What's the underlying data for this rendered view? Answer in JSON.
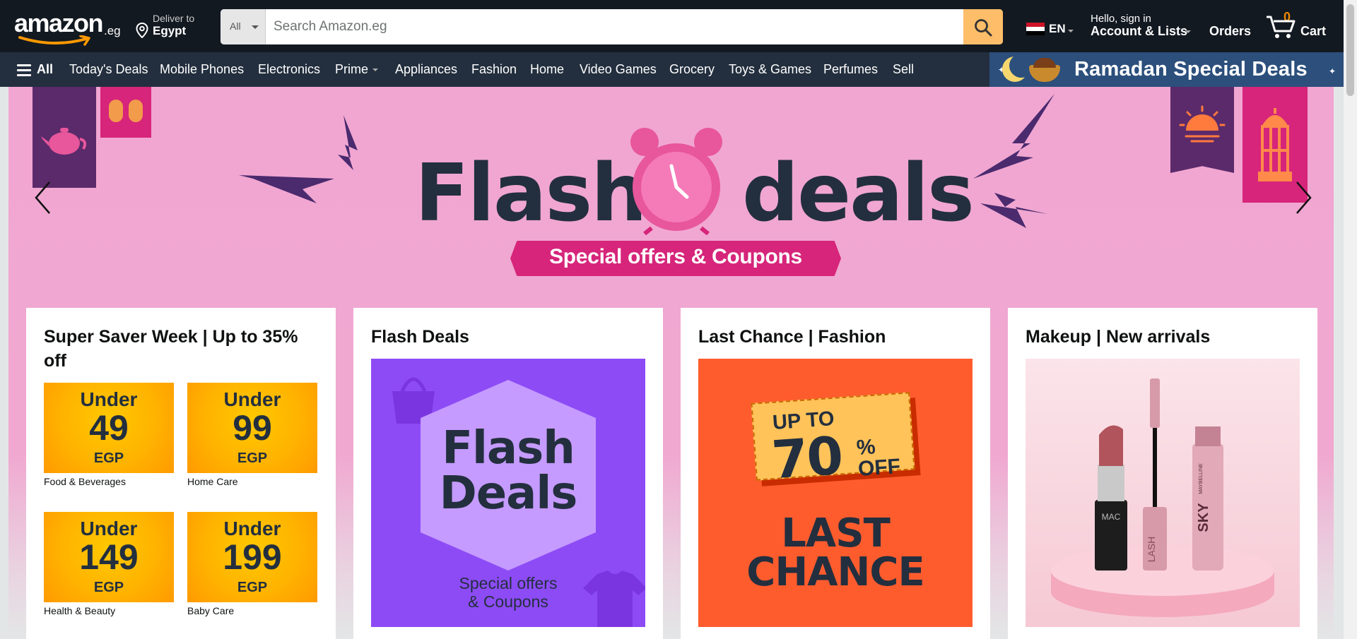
{
  "header": {
    "logo": {
      "text": "amazon",
      "tld": ".eg"
    },
    "deliver": {
      "line1": "Deliver to",
      "line2": "Egypt"
    },
    "search": {
      "category": "All",
      "placeholder": "Search Amazon.eg",
      "value": ""
    },
    "language": "EN",
    "account": {
      "line1": "Hello, sign in",
      "line2": "Account & Lists"
    },
    "orders": "Orders",
    "cart": {
      "count": "0",
      "label": "Cart"
    }
  },
  "subnav": {
    "all_label": "All",
    "items": [
      "Today's Deals",
      "Mobile Phones",
      "Electronics",
      "Prime",
      "Appliances",
      "Fashion",
      "Home",
      "Video Games",
      "Grocery",
      "Toys & Games",
      "Perfumes",
      "Sell"
    ],
    "promo": "Ramadan Special Deals"
  },
  "hero": {
    "title_left": "Flash",
    "title_right": "deals",
    "subtitle": "Special offers & Coupons",
    "colors": {
      "background": "#f1a6d2",
      "accent": "#d6257a",
      "dark": "#232f3e",
      "purple": "#5b2a6b"
    }
  },
  "cards": [
    {
      "title": "Super Saver Week | Up to 35% off",
      "tiles": [
        {
          "under": "Under",
          "price": "49",
          "currency": "EGP",
          "caption": "Food & Beverages"
        },
        {
          "under": "Under",
          "price": "99",
          "currency": "EGP",
          "caption": "Home Care"
        },
        {
          "under": "Under",
          "price": "149",
          "currency": "EGP",
          "caption": "Health & Beauty"
        },
        {
          "under": "Under",
          "price": "199",
          "currency": "EGP",
          "caption": "Baby Care"
        }
      ]
    },
    {
      "title": "Flash Deals",
      "image": {
        "line1": "Flash",
        "line2": "Deals",
        "small1": "Special offers",
        "small2": "& Coupons"
      }
    },
    {
      "title": "Last Chance | Fashion",
      "image": {
        "upto": "UP TO",
        "percent": "70",
        "pct_sign": "%",
        "off": "OFF",
        "line1": "LAST",
        "line2": "CHANCE"
      }
    },
    {
      "title": "Makeup | New arrivals",
      "image": {
        "lipstick_brand": "MAC",
        "mascara_brand": "MAYBELLINE",
        "mascara_name": "SKY",
        "mascara2_name": "LASH"
      }
    }
  ]
}
